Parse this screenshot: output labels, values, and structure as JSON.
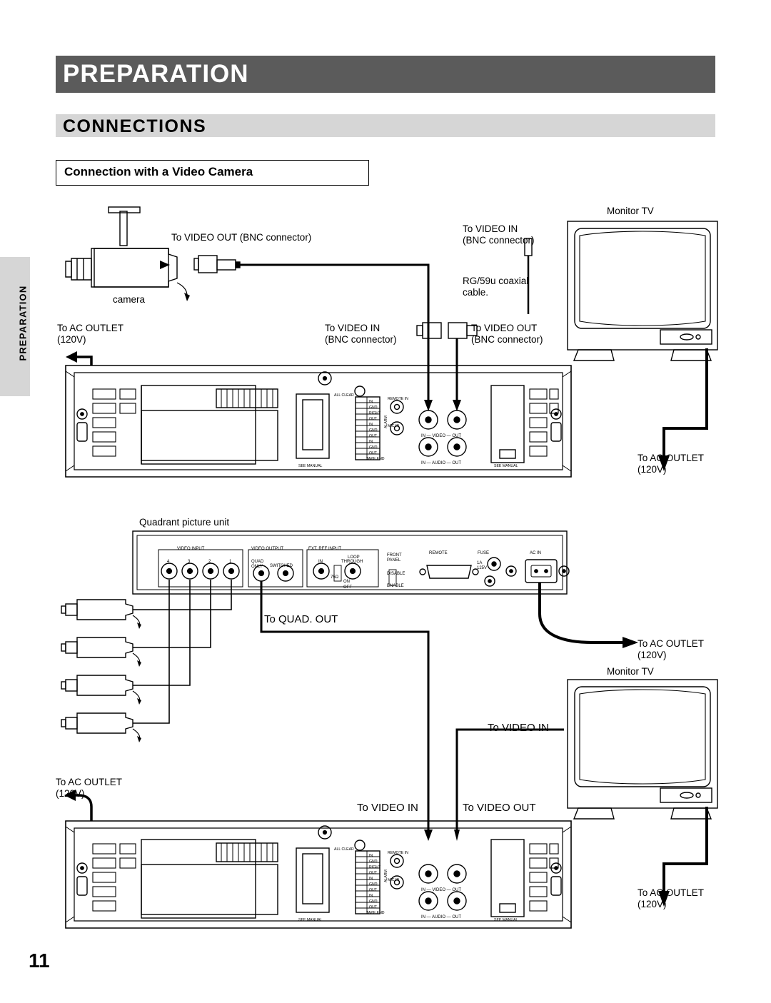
{
  "header": {
    "chapter": "PREPARATION",
    "section": "CONNECTIONS",
    "subsection": "Connection with a Video Camera"
  },
  "side_tab": {
    "label": "PREPARATION"
  },
  "page_number": "11",
  "diagram_top": {
    "camera_caption": "camera",
    "video_out_bnc": "To VIDEO OUT (BNC connector)",
    "video_in_bnc": "To VIDEO IN\n(BNC connector)",
    "coax_cable": "RG/59u coaxial\ncable.",
    "monitor_tv": "Monitor TV",
    "ac_outlet_left": "To AC OUTLET\n(120V)",
    "vcr_video_in": "To VIDEO IN\n(BNC connector)",
    "vcr_video_out": "To VIDEO OUT\n(BNC connector)",
    "ac_outlet_right": "To AC OUTLET\n(120V)"
  },
  "diagram_bottom": {
    "quadrant_unit": "Quadrant picture unit",
    "to_quad_out": "To QUAD. OUT",
    "ac_outlet_quad": "To AC OUTLET\n(120V)",
    "monitor_tv": "Monitor TV",
    "monitor_video_in": "To VIDEO IN",
    "ac_outlet_left": "To AC OUTLET\n(120V)",
    "vcr_video_in": "To VIDEO IN",
    "vcr_video_out": "To VIDEO OUT",
    "ac_outlet_right": "To AC OUTLET\n(120V)"
  },
  "vcr_panel": {
    "all_clear": "ALL CLEAR",
    "remote_in": "REMOTE IN",
    "mic_in": "MIC IN",
    "see_manual_left": "SEE MANUAL",
    "see_manual_right": "SEE MANUAL",
    "video_row": "IN — VIDEO — OUT",
    "audio_row": "IN — AUDIO — OUT",
    "alarm": "ALARM",
    "terminal_labels": [
      "IN",
      "GND",
      "RIGHT",
      "OUT",
      "IN",
      "GND",
      "OUT",
      "IN",
      "GND",
      "OUT",
      "TAPE END"
    ]
  },
  "quad_panel": {
    "video_input": "VIDEO INPUT",
    "video_input_nums": [
      "4",
      "3",
      "2",
      "1"
    ],
    "video_output": "VIDEO OUTPUT",
    "quad_only": "QUAD\nONLY",
    "switched": "SWITCHED",
    "ext_ref_input": "EXT. REF INPUT",
    "loop": "LOOP",
    "in": "IN",
    "through": "THROUGH",
    "ohm75": "75Ω",
    "on": "ON",
    "off": "OFF",
    "front_panel": "FRONT\nPANEL",
    "disable": "DISABLE",
    "enable": "ENABLE",
    "remote": "REMOTE",
    "fuse": "FUSE",
    "fuse_rating": "1A\n125V",
    "ac_in": "AC IN"
  }
}
